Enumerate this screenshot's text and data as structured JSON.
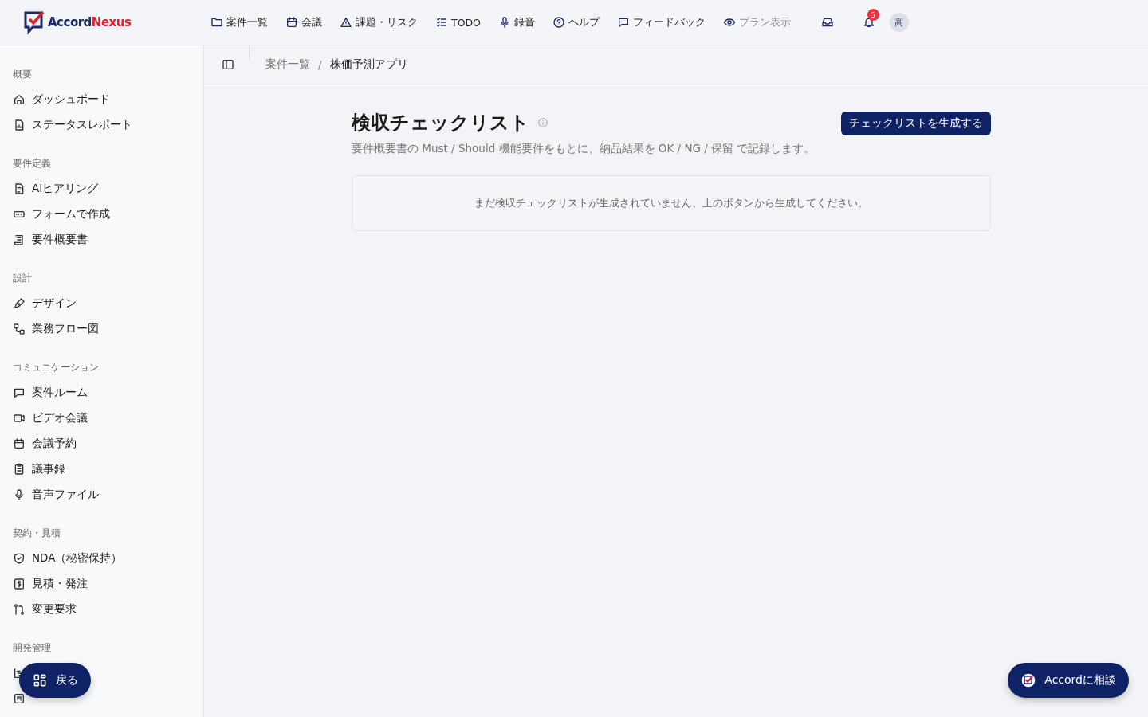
{
  "header": {
    "logo": {
      "first": "Accord",
      "second": "Nexus"
    },
    "nav": [
      {
        "label": "案件一覧",
        "kind": "folder",
        "disabled": false
      },
      {
        "label": "会議",
        "kind": "calendar",
        "disabled": false
      },
      {
        "label": "課題・リスク",
        "kind": "warning",
        "disabled": false
      },
      {
        "label": "TODO",
        "kind": "checklist",
        "disabled": false
      },
      {
        "label": "録音",
        "kind": "mic",
        "disabled": false
      },
      {
        "label": "ヘルプ",
        "kind": "help",
        "disabled": false
      },
      {
        "label": "フィードバック",
        "kind": "chat",
        "disabled": false
      },
      {
        "label": "プラン表示",
        "kind": "eye",
        "disabled": true
      }
    ],
    "notification_count": "5",
    "avatar": "高"
  },
  "sidebar": {
    "sections": [
      {
        "title": "概要",
        "items": [
          {
            "label": "ダッシュボード",
            "kind": "home"
          },
          {
            "label": "ステータスレポート",
            "kind": "report"
          }
        ]
      },
      {
        "title": "要件定義",
        "items": [
          {
            "label": "AIヒアリング",
            "kind": "doc"
          },
          {
            "label": "フォームで作成",
            "kind": "form"
          },
          {
            "label": "要件概要書",
            "kind": "scroll"
          }
        ]
      },
      {
        "title": "設計",
        "items": [
          {
            "label": "デザイン",
            "kind": "pen"
          },
          {
            "label": "業務フロー図",
            "kind": "flow"
          }
        ]
      },
      {
        "title": "コミュニケーション",
        "items": [
          {
            "label": "案件ルーム",
            "kind": "chat"
          },
          {
            "label": "ビデオ会議",
            "kind": "video"
          },
          {
            "label": "会議予約",
            "kind": "calendar"
          },
          {
            "label": "議事録",
            "kind": "clipboard"
          },
          {
            "label": "音声ファイル",
            "kind": "mic"
          }
        ]
      },
      {
        "title": "契約・見積",
        "items": [
          {
            "label": "NDA（秘密保持）",
            "kind": "shield"
          },
          {
            "label": "見積・発注",
            "kind": "dollar"
          },
          {
            "label": "変更要求",
            "kind": "branch"
          }
        ]
      },
      {
        "title": "開発管理",
        "items": [
          {
            "kind": "gantt"
          },
          {
            "kind": "kanban"
          }
        ]
      }
    ]
  },
  "breadcrumb": {
    "separator": "/",
    "items": [
      {
        "label": "案件一覧",
        "current": false
      },
      {
        "label": "株価予測アプリ",
        "current": true
      }
    ]
  },
  "page": {
    "title": "検収チェックリスト",
    "description": "要件概要書の Must / Should 機能要件をもとに、納品結果を OK / NG / 保留 で記録します。",
    "generate_button": "チェックリストを生成する",
    "empty_message": "まだ検収チェックリストが生成されていません。上のボタンから生成してください。"
  },
  "floating": {
    "back_button": "戻る",
    "consult_button": "Accordに相談"
  }
}
